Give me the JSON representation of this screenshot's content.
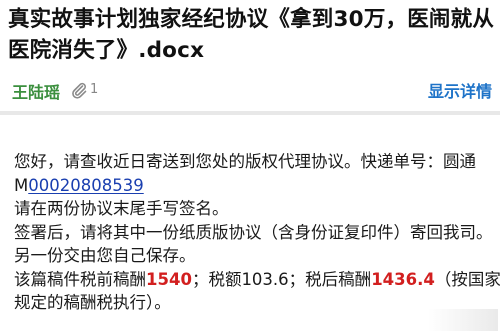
{
  "email": {
    "subject": "真实故事计划独家经纪协议《拿到30万，医闹就从医院消失了》.docx",
    "sender": "王陆瑶",
    "attachment_count": "1",
    "details_link": "显示详情"
  },
  "body": {
    "greeting": "您好，请查收近日寄送到您处的版权代理协议。快递单号：圆通",
    "tracking_prefix": "M",
    "tracking_number": "00020808539",
    "line3": "请在两份协议末尾手写签名。",
    "line4": "签署后，请将其中一份纸质版协议（含身份证复印件）寄回我司。",
    "line5": "另一份交由您自己保存。",
    "fee_text_1": "该篇稿件税前稿酬",
    "fee_pretax": "1540",
    "fee_text_2": "；税额103.6；税后稿酬",
    "fee_aftertax": "1436.4",
    "fee_text_3": "（按国家",
    "line7": "规定的稿酬税执行）。"
  },
  "colors": {
    "sender": "#3b8f3e",
    "link": "#1e73c8",
    "amount": "#d21f1f",
    "tracking": "#1a3fb0"
  }
}
